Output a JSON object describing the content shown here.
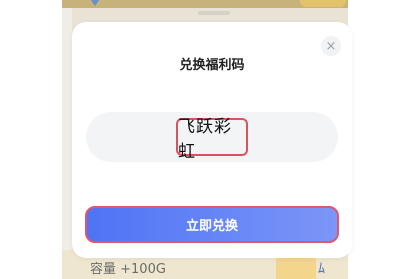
{
  "background": {
    "capacity_label": "容量 +100G",
    "decor_mark": "ﾑ",
    "colors": {
      "app_bg": "#e9e3d6",
      "banner": "#c7b27a"
    }
  },
  "dialog": {
    "title": "兑换福利码",
    "close_icon": "×",
    "code_value": "飞跃彩虹",
    "redeem_label": "立即兑换",
    "colors": {
      "button_gradient_start": "#4f73f6",
      "button_gradient_end": "#7c96f7",
      "highlight_border": "#d9535f"
    }
  }
}
